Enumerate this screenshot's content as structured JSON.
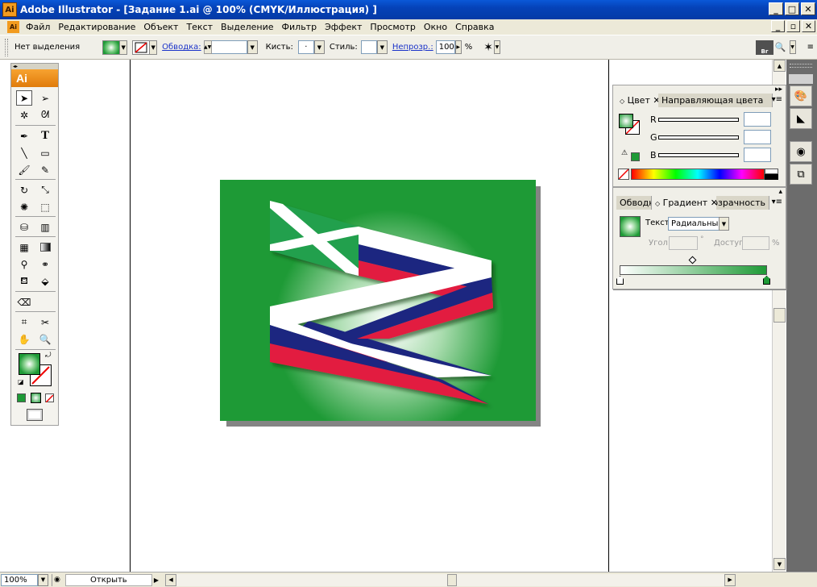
{
  "window": {
    "title": "Adobe Illustrator - [Задание 1.ai @ 100% (CMYK/Иллюстрация) ]",
    "app_icon_text": "Ai",
    "minimize": "_",
    "maximize": "□",
    "close": "✕",
    "restore": "▫"
  },
  "menu": {
    "items": [
      "Файл",
      "Редактирование",
      "Объект",
      "Текст",
      "Выделение",
      "Фильтр",
      "Эффект",
      "Просмотр",
      "Окно",
      "Справка"
    ]
  },
  "control_bar": {
    "selection_status": "Нет выделения",
    "stroke_label": "Обводка:",
    "brush_label": "Кисть:",
    "brush_value": "·",
    "style_label": "Стиль:",
    "opacity_label": "Непрозр.:",
    "opacity_value": "100",
    "opacity_unit": "%",
    "bridge_label": "Br"
  },
  "toolbox": {
    "logo": "Ai"
  },
  "color_panel": {
    "tabs": [
      "Цвет",
      "Направляющая цвета"
    ],
    "channels": [
      "R",
      "G",
      "B"
    ]
  },
  "gradient_panel": {
    "tabs": [
      "Обводка",
      "Градиент",
      "Прозрачность"
    ],
    "type_label": "Текст:",
    "type_value": "Радиальный",
    "angle_label": "Угол:",
    "angle_unit": "°",
    "location_label": "Доступ:",
    "location_unit": "%"
  },
  "status_bar": {
    "zoom": "100%",
    "status_text": "Открыть"
  },
  "colors": {
    "artboard_green": "#1e9a36",
    "flag_white": "#ffffff",
    "flag_blue": "#1c2580",
    "flag_red": "#e21f3f",
    "andrew_green": "#23a04e"
  }
}
